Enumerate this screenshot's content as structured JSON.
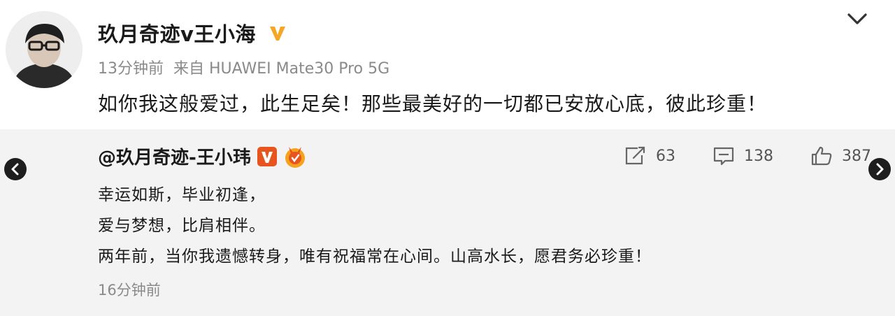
{
  "post": {
    "author": "玖月奇迹v王小海",
    "time": "13分钟前",
    "source": "来自 HUAWEI Mate30 Pro 5G",
    "text": "如你我这般爱过，此生足矣！那些最美好的一切都已安放心底，彼此珍重！"
  },
  "repost": {
    "author": "@玖月奇迹-王小玮",
    "lines": [
      "幸运如斯，毕业初逢，",
      "爱与梦想，比肩相伴。",
      "两年前，当你我遗憾转身，唯有祝福常在心间。山高水长，愿君务必珍重！"
    ],
    "time": "16分钟前",
    "actions": {
      "repost_count": "63",
      "comment_count": "138",
      "like_count": "387"
    }
  },
  "colors": {
    "verified_badge": "#f5a623",
    "verified_badge_red": "#e8541e",
    "repost_background": "#f3f3f3",
    "nav_arrow": "#1e1e1e"
  },
  "icons": {
    "verified": "verified-v-icon",
    "chevron": "chevron-down-icon",
    "repost": "repost-icon",
    "comment": "comment-icon",
    "like": "thumbs-up-icon",
    "nav_left": "arrow-left-icon",
    "nav_right": "arrow-right-icon"
  }
}
